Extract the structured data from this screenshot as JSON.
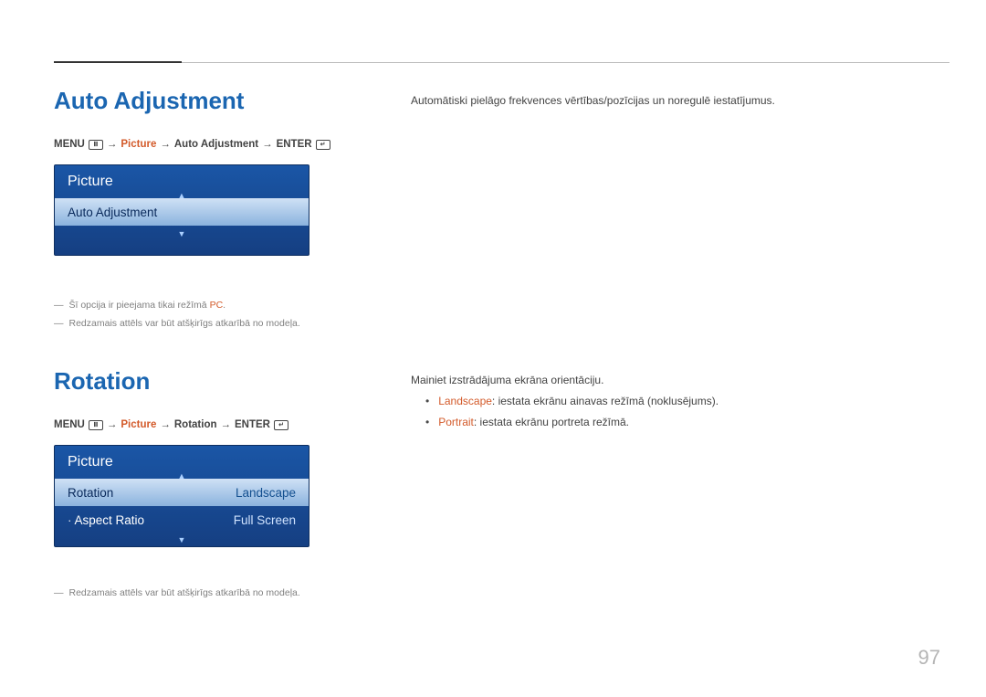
{
  "page_number": "97",
  "section1": {
    "heading": "Auto Adjustment",
    "breadcrumb": {
      "menu": "MENU",
      "arrow": "→",
      "picture": "Picture",
      "item": "Auto Adjustment",
      "enter": "ENTER"
    },
    "screenshot": {
      "header": "Picture",
      "row_label": "Auto Adjustment"
    },
    "notes": {
      "n1_pre": "Šī opcija ir pieejama tikai režīmā",
      "n1_kw": "PC",
      "n1_suffix": ".",
      "n2": "Redzamais attēls var būt atšķirīgs atkarībā no modeļa."
    },
    "right": "Automātiski pielāgo frekvences vērtības/pozīcijas un noregulē iestatījumus."
  },
  "section2": {
    "heading": "Rotation",
    "breadcrumb": {
      "menu": "MENU",
      "arrow": "→",
      "picture": "Picture",
      "item": "Rotation",
      "enter": "ENTER"
    },
    "screenshot": {
      "header": "Picture",
      "row1_label": "Rotation",
      "row1_value": "Landscape",
      "row2_label": "Aspect Ratio",
      "row2_value": "Full Screen",
      "row2_marker": "·"
    },
    "notes": {
      "n1": "Redzamais attēls var būt atšķirīgs atkarībā no modeļa."
    },
    "right": {
      "intro": "Mainiet izstrādājuma ekrāna orientāciju.",
      "b1_kw": "Landscape",
      "b1_text": ": iestata ekrānu ainavas režīmā (noklusējums).",
      "b2_kw": "Portrait",
      "b2_text": ": iestata ekrānu portreta režīmā."
    }
  }
}
